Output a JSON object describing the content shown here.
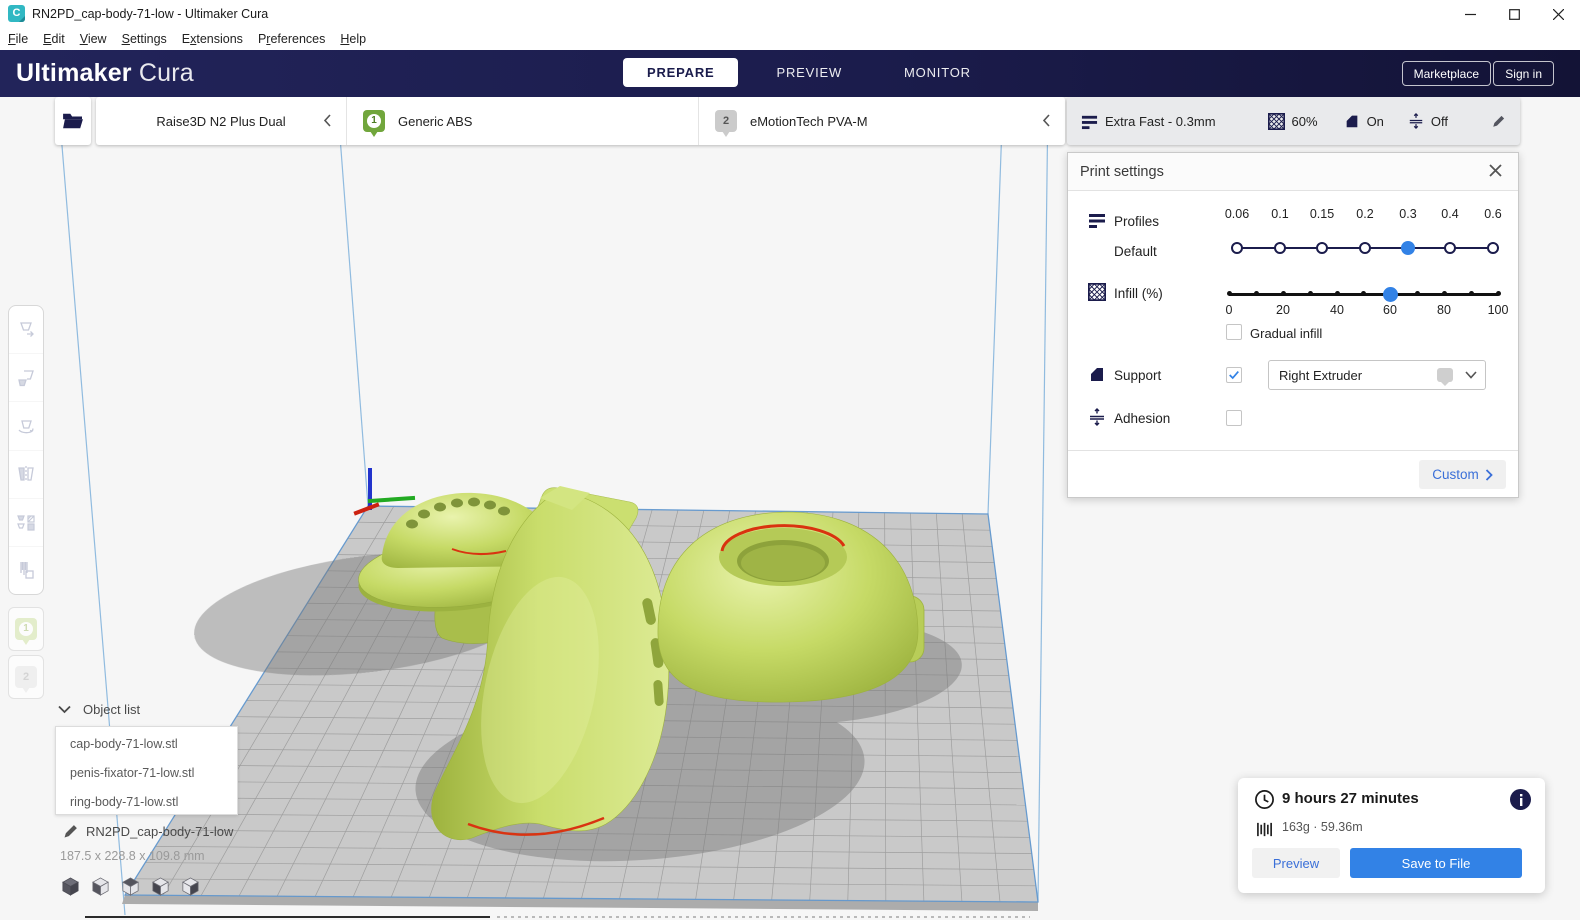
{
  "window": {
    "logo_letter": "C",
    "title": "RN2PD_cap-body-71-low - Ultimaker Cura"
  },
  "menu": {
    "items": [
      {
        "label": "File",
        "accel": 0
      },
      {
        "label": "Edit",
        "accel": 0
      },
      {
        "label": "View",
        "accel": 0
      },
      {
        "label": "Settings",
        "accel": 0
      },
      {
        "label": "Extensions",
        "accel": 1
      },
      {
        "label": "Preferences",
        "accel": 1
      },
      {
        "label": "Help",
        "accel": 0
      }
    ]
  },
  "header": {
    "brand_bold": "Ultimaker",
    "brand_light": "Cura",
    "tabs": [
      {
        "label": "PREPARE"
      },
      {
        "label": "PREVIEW"
      },
      {
        "label": "MONITOR"
      }
    ],
    "active_tab": "PREPARE",
    "marketplace_label": "Marketplace",
    "signin_label": "Sign in"
  },
  "configbar": {
    "printer_name": "Raise3D N2 Plus Dual",
    "extruders": [
      {
        "num": "1",
        "material": "Generic ABS"
      },
      {
        "num": "2",
        "material": "eMotionTech PVA-M"
      }
    ],
    "summary": {
      "profile": "Extra Fast - 0.3mm",
      "infill": "60%",
      "support": "On",
      "adhesion": "Off"
    }
  },
  "print_settings": {
    "title": "Print settings",
    "profiles_label": "Profiles",
    "profile_name": "Default",
    "layer_heights": [
      "0.06",
      "0.1",
      "0.15",
      "0.2",
      "0.3",
      "0.4",
      "0.6"
    ],
    "selected_layer_height": "0.3",
    "infill_label": "Infill (%)",
    "infill_scale": [
      "0",
      "20",
      "40",
      "60",
      "80",
      "100"
    ],
    "infill_percent": "60",
    "gradual_infill_label": "Gradual infill",
    "support_label": "Support",
    "support_enabled": true,
    "support_extruder": "Right Extruder",
    "adhesion_label": "Adhesion",
    "adhesion_enabled": false,
    "custom_label": "Custom"
  },
  "object_list": {
    "title": "Object list",
    "items": [
      "cap-body-71-low.stl",
      "penis-fixator-71-low.stl",
      "ring-body-71-low.stl"
    ]
  },
  "job": {
    "name": "RN2PD_cap-body-71-low",
    "dimensions": "187.5 x 228.8 x 109.8 mm"
  },
  "output": {
    "print_time": "9 hours 27 minutes",
    "material_usage": "163g · 59.36m",
    "preview_label": "Preview",
    "save_label": "Save to File"
  },
  "colors": {
    "header_navy": "#1b1c4c",
    "accent_blue": "#3282e6",
    "cura_teal": "#31b8c3",
    "model_green": "#c3d863",
    "buildplate_gray": "#c9c9c9"
  }
}
